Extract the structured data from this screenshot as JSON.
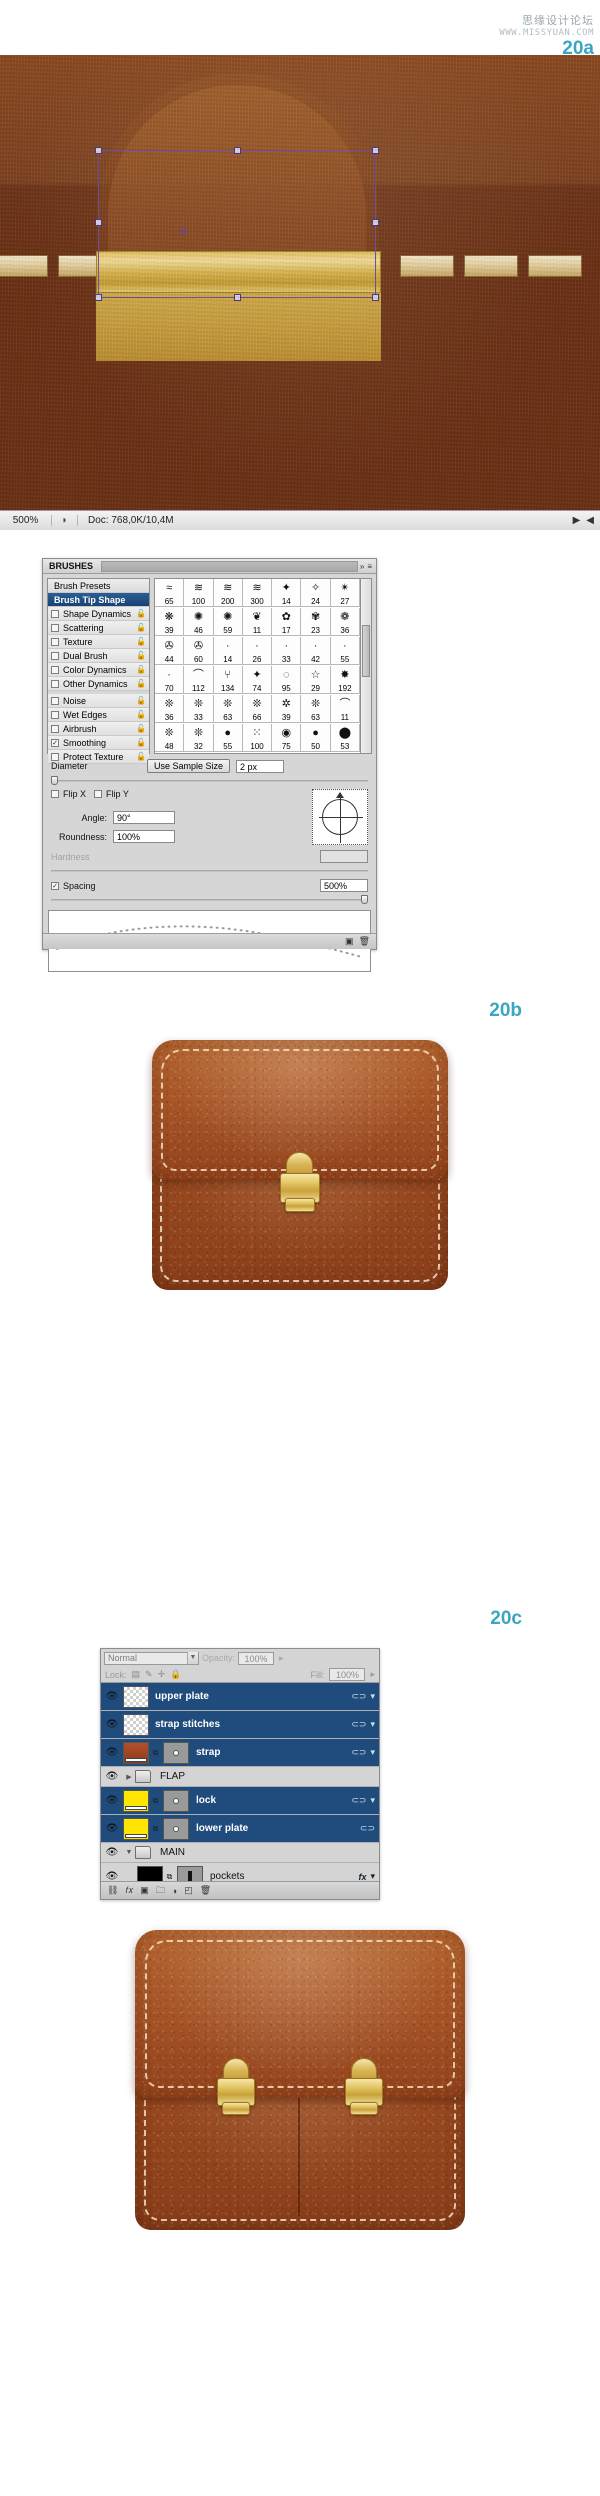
{
  "watermark": {
    "cn": "思缘设计论坛",
    "url": "WWW.MISSYUAN.COM"
  },
  "steps": {
    "a": "20a",
    "b": "20b",
    "c": "20c"
  },
  "canvas_status": {
    "zoom": "500%",
    "doc": "Doc: 768,0K/10,4M",
    "icon": "document-thumb-icon",
    "next_arrow": "▶",
    "left_arrow": "◀"
  },
  "brushes_panel": {
    "tab_label": "BRUSHES",
    "collapse_icon": "»",
    "menu_icon": "≡",
    "options": [
      {
        "label": "Brush Presets",
        "type": "header",
        "checked": false,
        "lock": false
      },
      {
        "label": "Brush Tip Shape",
        "type": "selected",
        "checked": false,
        "lock": false
      },
      {
        "label": "Shape Dynamics",
        "type": "check",
        "checked": false,
        "lock": true
      },
      {
        "label": "Scattering",
        "type": "check",
        "checked": false,
        "lock": true
      },
      {
        "label": "Texture",
        "type": "check",
        "checked": false,
        "lock": true
      },
      {
        "label": "Dual Brush",
        "type": "check",
        "checked": false,
        "lock": true
      },
      {
        "label": "Color Dynamics",
        "type": "check",
        "checked": false,
        "lock": true
      },
      {
        "label": "Other Dynamics",
        "type": "check",
        "checked": false,
        "lock": true
      },
      {
        "label": "Noise",
        "type": "check",
        "checked": false,
        "lock": true
      },
      {
        "label": "Wet Edges",
        "type": "check",
        "checked": false,
        "lock": true
      },
      {
        "label": "Airbrush",
        "type": "check",
        "checked": false,
        "lock": true
      },
      {
        "label": "Smoothing",
        "type": "check",
        "checked": true,
        "lock": true
      },
      {
        "label": "Protect Texture",
        "type": "check",
        "checked": false,
        "lock": true
      }
    ],
    "brush_grid": {
      "columns": 7,
      "sizes": [
        65,
        100,
        200,
        300,
        14,
        24,
        27,
        39,
        46,
        59,
        11,
        17,
        23,
        36,
        44,
        60,
        14,
        26,
        33,
        42,
        55,
        70,
        112,
        134,
        74,
        95,
        29,
        192,
        36,
        33,
        63,
        66,
        39,
        63,
        11,
        48,
        32,
        55,
        100,
        75,
        50,
        53
      ],
      "glyphs": [
        "≈",
        "≋",
        "≋",
        "≋",
        "✦",
        "✧",
        "✴",
        "❋",
        "✺",
        "✺",
        "❦",
        "✿",
        "✾",
        "❁",
        "✇",
        "✇",
        "·",
        "·",
        "·",
        "·",
        "·",
        "·",
        "⌒",
        "⑂",
        "✦",
        "◌",
        "☆",
        "✸",
        "❊",
        "❊",
        "❊",
        "❊",
        "✲",
        "❊",
        "⌒",
        "❊",
        "❊",
        "●",
        "⁙",
        "◉",
        "●",
        "⬤"
      ]
    },
    "controls": {
      "diameter_label": "Diameter",
      "use_sample_size": "Use Sample Size",
      "diameter_value": "2 px",
      "flip_x": "Flip X",
      "flip_y": "Flip Y",
      "flip_x_checked": false,
      "flip_y_checked": false,
      "angle_label": "Angle:",
      "angle_value": "90°",
      "roundness_label": "Roundness:",
      "roundness_value": "100%",
      "hardness_label": "Hardness",
      "hardness_value": "",
      "hardness_disabled": true,
      "spacing_label": "Spacing",
      "spacing_checked": true,
      "spacing_value": "500%"
    },
    "footer_icons": [
      "new-brush-icon",
      "delete-brush-icon"
    ]
  },
  "layers_panel": {
    "blend_mode": "Normal",
    "opacity_label": "Opacity:",
    "opacity_value": "100%",
    "lock_label": "Lock:",
    "lock_icons": [
      "lock-transparent-icon",
      "lock-image-icon",
      "lock-position-icon",
      "lock-all-icon"
    ],
    "fill_label": "Fill:",
    "fill_value": "100%",
    "rows": [
      {
        "name": "upper plate",
        "kind": "layer",
        "selected": true,
        "thumb": "checker",
        "mask": false,
        "visible": true,
        "fx": false,
        "effects_marker": "⊂⊃"
      },
      {
        "name": "strap stitches",
        "kind": "layer",
        "selected": true,
        "thumb": "checker",
        "mask": false,
        "visible": true,
        "fx": false,
        "effects_marker": "⊂⊃"
      },
      {
        "name": "strap",
        "kind": "layer",
        "selected": true,
        "thumb": "leather",
        "mask": true,
        "visible": true,
        "fx": false,
        "effects_marker": "⊂⊃"
      },
      {
        "name": "FLAP",
        "kind": "group",
        "selected": false,
        "expanded": false,
        "visible": true
      },
      {
        "name": "lock",
        "kind": "layer",
        "selected": true,
        "thumb": "yellow",
        "mask": true,
        "visible": true,
        "fx": false,
        "effects_marker": "⊂⊃"
      },
      {
        "name": "lower plate",
        "kind": "layer",
        "selected": true,
        "thumb": "yellow",
        "mask": true,
        "visible": true,
        "fx": false,
        "effects_marker": "⊂⊃"
      },
      {
        "name": "MAIN",
        "kind": "group",
        "selected": false,
        "expanded": true,
        "visible": true
      },
      {
        "name": "pockets",
        "kind": "layer",
        "selected": false,
        "thumb": "black",
        "mask": true,
        "visible": true,
        "fx": true,
        "fx_label": "fx",
        "effects_marker": "▾"
      }
    ],
    "footer_icons": [
      "link-icon",
      "fx-icon",
      "mask-icon",
      "group-icon",
      "adjustment-icon",
      "new-layer-icon",
      "delete-layer-icon"
    ]
  },
  "colors": {
    "accent": "#3aa6c4",
    "leather_light": "#b4642f",
    "leather_dark": "#8a3e1a",
    "gold": "#e0bf5c",
    "stitch": "#f2dfc0",
    "layer_selected": "#1f4c7c"
  }
}
